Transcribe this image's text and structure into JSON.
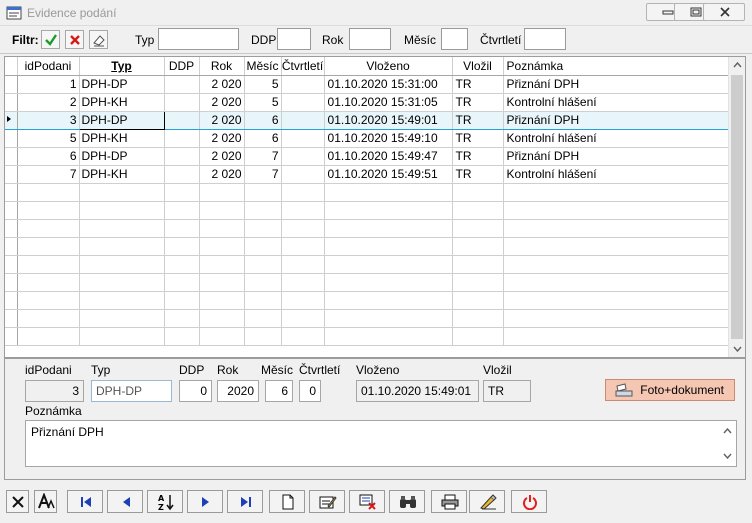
{
  "window": {
    "title": "Evidence podání"
  },
  "filter": {
    "label": "Filtr:",
    "typ_label": "Typ",
    "ddp_label": "DDP",
    "rok_label": "Rok",
    "mesic_label": "Měsíc",
    "ctvrtleti_label": "Čtvrtletí"
  },
  "grid": {
    "columns": [
      "idPodani",
      "Typ",
      "DDP",
      "Rok",
      "Měsíc",
      "Čtvrtletí",
      "Vloženo",
      "Vložil",
      "Poznámka"
    ],
    "rows": [
      [
        "1",
        "DPH-DP",
        "",
        "2 020",
        "5",
        "",
        "01.10.2020 15:31:00",
        "TR",
        "Přiznání DPH"
      ],
      [
        "2",
        "DPH-KH",
        "",
        "2 020",
        "5",
        "",
        "01.10.2020 15:31:05",
        "TR",
        "Kontrolní hlášení"
      ],
      [
        "3",
        "DPH-DP",
        "",
        "2 020",
        "6",
        "",
        "01.10.2020 15:49:01",
        "TR",
        "Přiznání DPH"
      ],
      [
        "5",
        "DPH-KH",
        "",
        "2 020",
        "6",
        "",
        "01.10.2020 15:49:10",
        "TR",
        "Kontrolní hlášení"
      ],
      [
        "6",
        "DPH-DP",
        "",
        "2 020",
        "7",
        "",
        "01.10.2020 15:49:47",
        "TR",
        "Přiznání DPH"
      ],
      [
        "7",
        "DPH-KH",
        "",
        "2 020",
        "7",
        "",
        "01.10.2020 15:49:51",
        "TR",
        "Kontrolní hlášení"
      ]
    ],
    "selected_index": 2
  },
  "detail": {
    "labels": {
      "id": "idPodani",
      "typ": "Typ",
      "ddp": "DDP",
      "rok": "Rok",
      "mesic": "Měsíc",
      "ctvrtleti": "Čtvrtletí",
      "vlozeno": "Vloženo",
      "vlozil": "Vložil",
      "poznamka": "Poznámka"
    },
    "values": {
      "id": "3",
      "typ": "DPH-DP",
      "ddp": "0",
      "rok": "2020",
      "mesic": "6",
      "ctvrtleti": "0",
      "vlozeno": "01.10.2020 15:49:01",
      "vlozil": "TR",
      "poznamka": "Přiznání DPH"
    },
    "foto_button": "Foto+dokument"
  },
  "colors": {
    "selection": "#e8f5fb",
    "selection_border": "#26a0da",
    "foto_button": "#f5c6b2",
    "nav_blue": "#1f3fb5",
    "power_red": "#e02020"
  }
}
